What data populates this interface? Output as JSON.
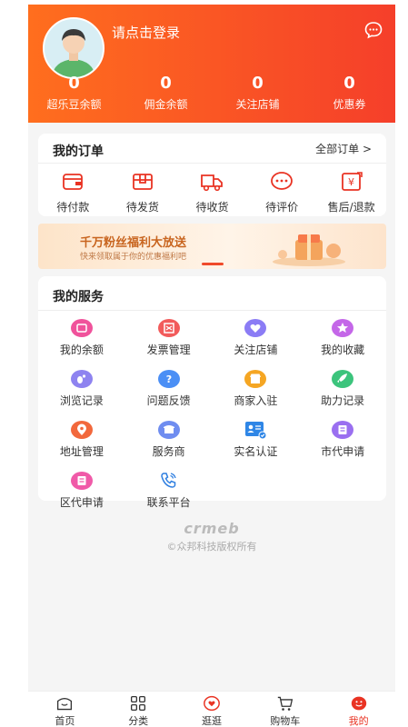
{
  "header": {
    "login_text": "请点击登录",
    "stats": [
      {
        "value": "0",
        "label": "超乐豆余额"
      },
      {
        "value": "0",
        "label": "佣金余额"
      },
      {
        "value": "0",
        "label": "关注店铺"
      },
      {
        "value": "0",
        "label": "优惠券"
      }
    ]
  },
  "orders": {
    "title": "我的订单",
    "all_link": "全部订单 >",
    "items": [
      {
        "label": "待付款",
        "icon": "wallet-icon"
      },
      {
        "label": "待发货",
        "icon": "package-icon"
      },
      {
        "label": "待收货",
        "icon": "truck-icon"
      },
      {
        "label": "待评价",
        "icon": "comment-icon"
      },
      {
        "label": "售后/退款",
        "icon": "refund-icon"
      }
    ]
  },
  "banner": {
    "title": "千万粉丝福利大放送",
    "subtitle": "快来领取属于你的优惠福利吧"
  },
  "services": {
    "title": "我的服务",
    "items": [
      {
        "label": "我的余额",
        "icon": "balance-icon",
        "color": "#f0529b"
      },
      {
        "label": "发票管理",
        "icon": "invoice-icon",
        "color": "#f25b5b"
      },
      {
        "label": "关注店铺",
        "icon": "heart-icon",
        "color": "#8b7cf5"
      },
      {
        "label": "我的收藏",
        "icon": "star-icon",
        "color": "#c467e8"
      },
      {
        "label": "浏览记录",
        "icon": "footprint-icon",
        "color": "#8e83f0"
      },
      {
        "label": "问题反馈",
        "icon": "question-icon",
        "color": "#4b8ff5"
      },
      {
        "label": "商家入驻",
        "icon": "shop-icon",
        "color": "#f5a623"
      },
      {
        "label": "助力记录",
        "icon": "rocket-icon",
        "color": "#3cc47c"
      },
      {
        "label": "地址管理",
        "icon": "location-icon",
        "color": "#f2683c"
      },
      {
        "label": "服务商",
        "icon": "store-icon",
        "color": "#6f8df0"
      },
      {
        "label": "实名认证",
        "icon": "id-card-icon",
        "color": "#2f86e6"
      },
      {
        "label": "市代申请",
        "icon": "apply-icon",
        "color": "#9a6ff0"
      },
      {
        "label": "区代申请",
        "icon": "apply-pink-icon",
        "color": "#f05aa8"
      },
      {
        "label": "联系平台",
        "icon": "phone-icon",
        "color": "#2f7fe0"
      }
    ]
  },
  "footer": {
    "logo": "crmeb",
    "copyright": "©众邦科技版权所有"
  },
  "tabbar": [
    {
      "label": "首页",
      "icon": "home-icon"
    },
    {
      "label": "分类",
      "icon": "category-icon"
    },
    {
      "label": "逛逛",
      "icon": "discover-icon"
    },
    {
      "label": "购物车",
      "icon": "cart-icon"
    },
    {
      "label": "我的",
      "icon": "user-icon",
      "active": true
    }
  ],
  "colors": {
    "accent": "#e93323",
    "header_start": "#ff6e1e",
    "header_end": "#f53f2a"
  }
}
